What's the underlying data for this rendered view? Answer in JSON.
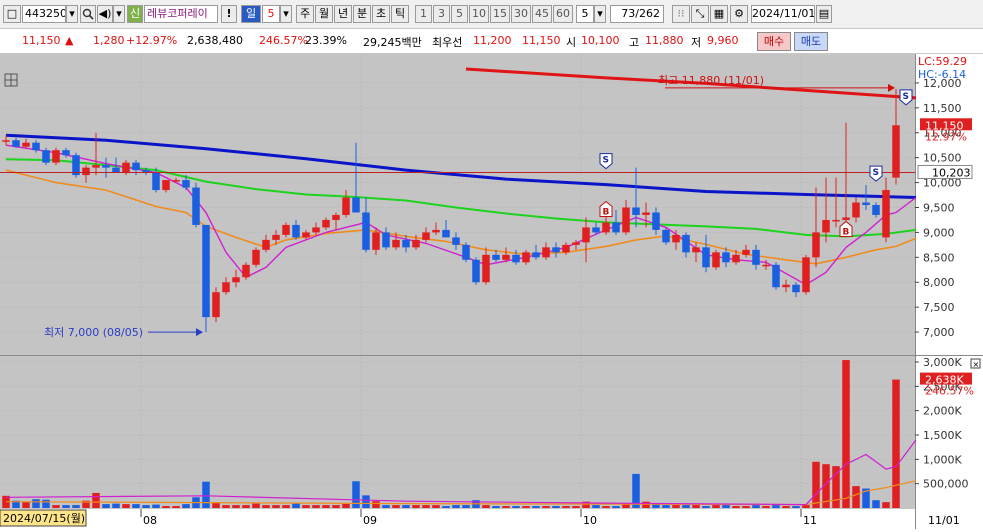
{
  "toolbar": {
    "code": "443250",
    "stock_badge": "신",
    "stock_name": "레뷰코퍼레이",
    "warning": "!",
    "period_day": "일",
    "period_num": "5",
    "periods": [
      "주",
      "월",
      "년",
      "분",
      "초",
      "틱"
    ],
    "intervals": [
      "1",
      "3",
      "5",
      "10",
      "15",
      "30",
      "45",
      "60"
    ],
    "interval_sel": "5",
    "page_count": "73/262",
    "date": "2024/11/01"
  },
  "quote": {
    "price": "11,150",
    "arrow": "▲",
    "change": "1,280",
    "change_pct": "+12.97%",
    "volume": "2,638,480",
    "volume_ratio": "246.57%",
    "turnover": "23.39%",
    "value": "29,245백만",
    "best_ask_label": "최우선",
    "best_ask": "11,200",
    "best_bid": "11,150",
    "open_label": "시",
    "open": "10,100",
    "high_label": "고",
    "high": "11,880",
    "low_label": "저",
    "low": "9,960",
    "buy_label": "매수",
    "sell_label": "매도"
  },
  "chart": {
    "lc_label": "LC:59.29",
    "hc_label": "HC:-6.14",
    "max_annot": "최고 11,880 (11/01)",
    "min_annot": "최저 7,000 (08/05)",
    "last_price_tag": "11,150",
    "last_pct_tag": "12.97%",
    "cursor_price": "10,203",
    "price_ticks": [
      "12,000",
      "11,500",
      "11,000",
      "10,500",
      "10,000",
      "9,500",
      "9,000",
      "8,500",
      "8,000",
      "7,500",
      "7,000"
    ],
    "vol_ticks": [
      "3,000K",
      "2,500K",
      "2,000K",
      "1,500K",
      "1,000K",
      "500,000"
    ],
    "vol_tag": "2,638K",
    "vol_pct_tag": "246.57%",
    "x_labels": [
      "2024/07/15(월)",
      "08",
      "09",
      "10",
      "11",
      "11/01"
    ],
    "signal_s": "S",
    "signal_b": "B"
  },
  "chart_data": {
    "type": "candlestick",
    "ylim": [
      6600,
      12500
    ],
    "vol_ylim": [
      0,
      3000000
    ],
    "colors": {
      "up": "#e02020",
      "down": "#1a5fe0",
      "ma5": "#d020d0",
      "ma20": "#f08c1e",
      "ma60": "#1ed21e",
      "ma120": "#0a14c8",
      "ma240": "#e01414"
    },
    "candles": [
      [
        10850,
        10950,
        10750,
        10850
      ],
      [
        10850,
        10900,
        10700,
        10720
      ],
      [
        10720,
        10880,
        10680,
        10800
      ],
      [
        10800,
        10850,
        10600,
        10650
      ],
      [
        10650,
        10700,
        10350,
        10400
      ],
      [
        10400,
        10700,
        10350,
        10650
      ],
      [
        10650,
        10700,
        10500,
        10550
      ],
      [
        10550,
        10600,
        10100,
        10150
      ],
      [
        10150,
        10350,
        10000,
        10300
      ],
      [
        10300,
        11000,
        10150,
        10350
      ],
      [
        10350,
        10500,
        10100,
        10300
      ],
      [
        10300,
        10500,
        10200,
        10200
      ],
      [
        10200,
        10450,
        10150,
        10400
      ],
      [
        10400,
        10450,
        10150,
        10250
      ],
      [
        10250,
        10300,
        10150,
        10200
      ],
      [
        10200,
        10300,
        9800,
        9850
      ],
      [
        9850,
        10050,
        9800,
        10050
      ],
      [
        10050,
        10100,
        10000,
        10050
      ],
      [
        10050,
        10150,
        9850,
        9900
      ],
      [
        9900,
        10000,
        9100,
        9150
      ],
      [
        9150,
        9150,
        7000,
        7300
      ],
      [
        7300,
        7900,
        7200,
        7800
      ],
      [
        7800,
        8100,
        7750,
        8000
      ],
      [
        8000,
        8250,
        7900,
        8100
      ],
      [
        8100,
        8400,
        8050,
        8350
      ],
      [
        8350,
        8700,
        8300,
        8650
      ],
      [
        8650,
        8950,
        8600,
        8850
      ],
      [
        8850,
        9050,
        8750,
        8950
      ],
      [
        8950,
        9200,
        8900,
        9150
      ],
      [
        9150,
        9250,
        8850,
        8900
      ],
      [
        8900,
        9050,
        8850,
        9000
      ],
      [
        9000,
        9200,
        8950,
        9100
      ],
      [
        9100,
        9300,
        9050,
        9250
      ],
      [
        9250,
        9400,
        9050,
        9350
      ],
      [
        9350,
        9850,
        9300,
        9700
      ],
      [
        9700,
        10800,
        9550,
        9400
      ],
      [
        9400,
        9700,
        8600,
        8650
      ],
      [
        8650,
        9100,
        8550,
        9000
      ],
      [
        9000,
        9100,
        8650,
        8700
      ],
      [
        8700,
        9000,
        8650,
        8850
      ],
      [
        8850,
        8950,
        8600,
        8700
      ],
      [
        8700,
        8950,
        8650,
        8850
      ],
      [
        8850,
        9100,
        8800,
        9000
      ],
      [
        9000,
        9200,
        8950,
        9050
      ],
      [
        9050,
        9250,
        8950,
        8900
      ],
      [
        8900,
        9000,
        8650,
        8750
      ],
      [
        8750,
        8800,
        8400,
        8450
      ],
      [
        8450,
        8500,
        7950,
        8000
      ],
      [
        8000,
        8700,
        7950,
        8550
      ],
      [
        8550,
        8650,
        8400,
        8450
      ],
      [
        8450,
        8700,
        8400,
        8550
      ],
      [
        8550,
        8650,
        8350,
        8400
      ],
      [
        8400,
        8650,
        8350,
        8600
      ],
      [
        8600,
        8750,
        8450,
        8500
      ],
      [
        8500,
        8800,
        8450,
        8700
      ],
      [
        8700,
        8800,
        8500,
        8600
      ],
      [
        8600,
        8800,
        8550,
        8750
      ],
      [
        8750,
        8850,
        8650,
        8800
      ],
      [
        8800,
        9300,
        8400,
        9100
      ],
      [
        9100,
        9200,
        8950,
        9000
      ],
      [
        9000,
        9350,
        8950,
        9200
      ],
      [
        9200,
        9450,
        8950,
        9000
      ],
      [
        9000,
        9650,
        8950,
        9500
      ],
      [
        9500,
        10300,
        9100,
        9350
      ],
      [
        9350,
        9600,
        9100,
        9400
      ],
      [
        9400,
        9500,
        8950,
        9050
      ],
      [
        9050,
        9100,
        8750,
        8800
      ],
      [
        8800,
        9050,
        8650,
        8950
      ],
      [
        8950,
        9000,
        8500,
        8600
      ],
      [
        8600,
        8800,
        8400,
        8700
      ],
      [
        8700,
        8950,
        8200,
        8300
      ],
      [
        8300,
        8650,
        8250,
        8600
      ],
      [
        8600,
        8700,
        8300,
        8400
      ],
      [
        8400,
        8650,
        8350,
        8550
      ],
      [
        8550,
        8750,
        8500,
        8650
      ],
      [
        8650,
        8750,
        8250,
        8350
      ],
      [
        8350,
        8450,
        8250,
        8350
      ],
      [
        8350,
        8400,
        7850,
        7900
      ],
      [
        7900,
        8050,
        7800,
        7950
      ],
      [
        7950,
        8000,
        7700,
        7800
      ],
      [
        7800,
        8550,
        7750,
        8500
      ],
      [
        8500,
        9900,
        8300,
        9000
      ],
      [
        9000,
        10100,
        8800,
        9250
      ],
      [
        9250,
        10100,
        9100,
        9250
      ],
      [
        9250,
        11200,
        9050,
        9300
      ],
      [
        9300,
        9700,
        9200,
        9600
      ],
      [
        9600,
        9950,
        9450,
        9550
      ],
      [
        9550,
        9600,
        9300,
        9350
      ],
      [
        8900,
        10100,
        8800,
        9850
      ],
      [
        10100,
        11880,
        9960,
        11150
      ]
    ],
    "volumes": [
      250000,
      150000,
      120000,
      180000,
      170000,
      60000,
      60000,
      60000,
      150000,
      310000,
      80000,
      90000,
      80000,
      80000,
      60000,
      70000,
      40000,
      40000,
      80000,
      220000,
      540000,
      120000,
      60000,
      60000,
      60000,
      90000,
      60000,
      60000,
      60000,
      90000,
      60000,
      60000,
      60000,
      60000,
      90000,
      550000,
      260000,
      140000,
      60000,
      60000,
      60000,
      60000,
      60000,
      60000,
      40000,
      60000,
      60000,
      160000,
      60000,
      40000,
      40000,
      40000,
      40000,
      40000,
      40000,
      40000,
      40000,
      40000,
      130000,
      60000,
      40000,
      40000,
      90000,
      700000,
      130000,
      90000,
      60000,
      60000,
      60000,
      60000,
      40000,
      60000,
      60000,
      40000,
      40000,
      60000,
      40000,
      60000,
      40000,
      40000,
      60000,
      950000,
      900000,
      860000,
      3040000,
      450000,
      400000,
      160000,
      120000,
      2638480
    ],
    "ma120_pts": [
      [
        0,
        10950
      ],
      [
        10,
        10850
      ],
      [
        20,
        10680
      ],
      [
        30,
        10480
      ],
      [
        40,
        10250
      ],
      [
        50,
        10070
      ],
      [
        60,
        9960
      ],
      [
        70,
        9820
      ],
      [
        80,
        9760
      ],
      [
        91,
        9700
      ]
    ],
    "ma240_pts": [
      [
        46,
        12280
      ],
      [
        60,
        12100
      ],
      [
        70,
        11990
      ],
      [
        80,
        11850
      ],
      [
        91,
        11700
      ]
    ],
    "ma60_pts": [
      [
        0,
        10470
      ],
      [
        5,
        10450
      ],
      [
        10,
        10350
      ],
      [
        15,
        10250
      ],
      [
        20,
        10020
      ],
      [
        25,
        9870
      ],
      [
        30,
        9760
      ],
      [
        35,
        9710
      ],
      [
        40,
        9640
      ],
      [
        45,
        9500
      ],
      [
        50,
        9380
      ],
      [
        55,
        9280
      ],
      [
        60,
        9200
      ],
      [
        65,
        9160
      ],
      [
        70,
        9120
      ],
      [
        75,
        9070
      ],
      [
        80,
        8950
      ],
      [
        84,
        8920
      ],
      [
        88,
        8970
      ],
      [
        91,
        9050
      ]
    ],
    "ma20_pts": [
      [
        0,
        10250
      ],
      [
        5,
        10000
      ],
      [
        10,
        9850
      ],
      [
        15,
        9520
      ],
      [
        18,
        9400
      ],
      [
        20,
        9120
      ],
      [
        23,
        8900
      ],
      [
        26,
        8700
      ],
      [
        28,
        8850
      ],
      [
        32,
        8980
      ],
      [
        36,
        9050
      ],
      [
        40,
        8920
      ],
      [
        44,
        8820
      ],
      [
        48,
        8650
      ],
      [
        52,
        8560
      ],
      [
        56,
        8600
      ],
      [
        60,
        8720
      ],
      [
        63,
        8850
      ],
      [
        66,
        8930
      ],
      [
        70,
        8760
      ],
      [
        74,
        8560
      ],
      [
        78,
        8450
      ],
      [
        81,
        8370
      ],
      [
        84,
        8500
      ],
      [
        87,
        8650
      ],
      [
        89,
        8720
      ],
      [
        91,
        8880
      ]
    ],
    "ma5_pts": [
      [
        0,
        10750
      ],
      [
        5,
        10600
      ],
      [
        10,
        10380
      ],
      [
        15,
        10200
      ],
      [
        18,
        9900
      ],
      [
        20,
        9400
      ],
      [
        22,
        8600
      ],
      [
        24,
        8100
      ],
      [
        26,
        8300
      ],
      [
        28,
        8700
      ],
      [
        32,
        9000
      ],
      [
        36,
        9200
      ],
      [
        38,
        8950
      ],
      [
        42,
        8780
      ],
      [
        46,
        8500
      ],
      [
        48,
        8350
      ],
      [
        52,
        8500
      ],
      [
        56,
        8700
      ],
      [
        60,
        9050
      ],
      [
        63,
        9300
      ],
      [
        66,
        9100
      ],
      [
        70,
        8550
      ],
      [
        73,
        8450
      ],
      [
        76,
        8400
      ],
      [
        80,
        7950
      ],
      [
        82,
        8200
      ],
      [
        84,
        8700
      ],
      [
        86,
        9000
      ],
      [
        88,
        9350
      ],
      [
        89,
        9400
      ],
      [
        91,
        9700
      ]
    ]
  }
}
